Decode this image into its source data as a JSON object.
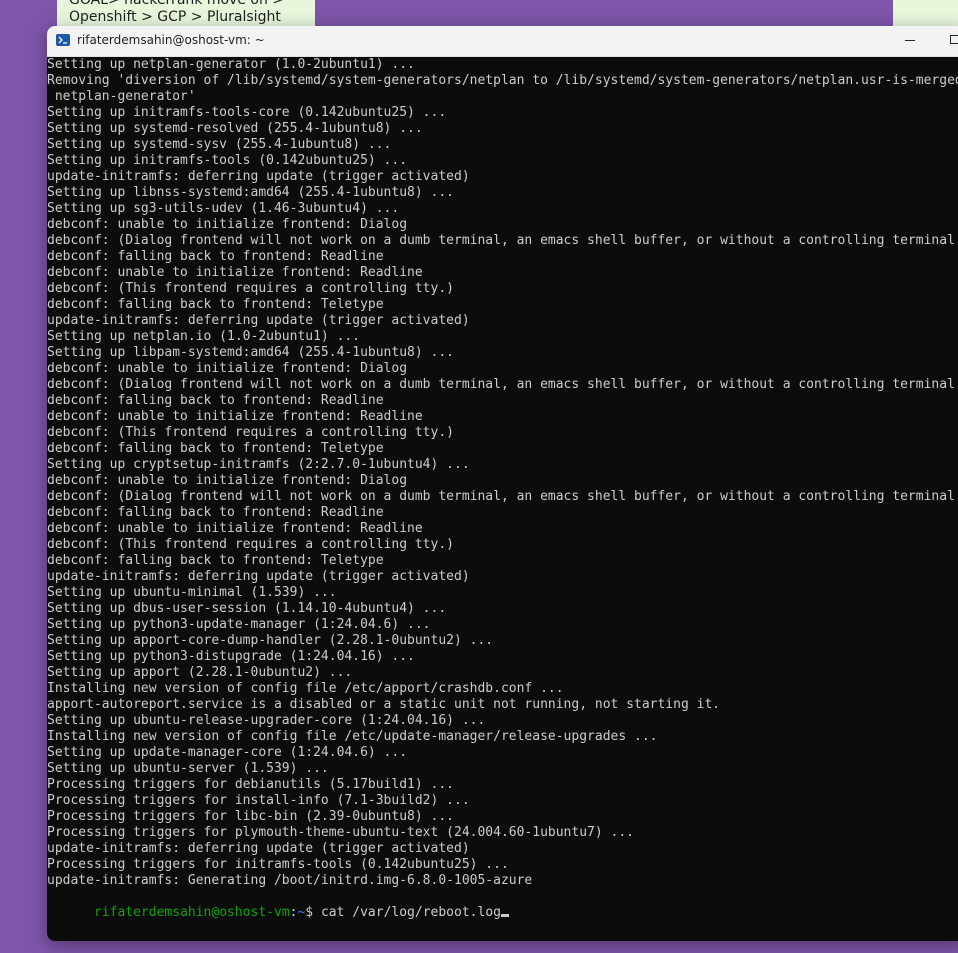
{
  "background_note": {
    "line1": "GOAL> hackerrank move on >",
    "line2": "Openshift > GCP > Pluralsight"
  },
  "window": {
    "title": "rifaterdemsahin@oshost-vm: ~",
    "icon": "terminal-icon"
  },
  "output_lines": [
    "Setting up netplan-generator (1.0-2ubuntu1) ...",
    "Removing 'diversion of /lib/systemd/system-generators/netplan to /lib/systemd/system-generators/netplan.usr-is-merged by",
    " netplan-generator'",
    "Setting up initramfs-tools-core (0.142ubuntu25) ...",
    "Setting up systemd-resolved (255.4-1ubuntu8) ...",
    "Setting up systemd-sysv (255.4-1ubuntu8) ...",
    "Setting up initramfs-tools (0.142ubuntu25) ...",
    "update-initramfs: deferring update (trigger activated)",
    "Setting up libnss-systemd:amd64 (255.4-1ubuntu8) ...",
    "Setting up sg3-utils-udev (1.46-3ubuntu4) ...",
    "debconf: unable to initialize frontend: Dialog",
    "debconf: (Dialog frontend will not work on a dumb terminal, an emacs shell buffer, or without a controlling terminal.)",
    "debconf: falling back to frontend: Readline",
    "debconf: unable to initialize frontend: Readline",
    "debconf: (This frontend requires a controlling tty.)",
    "debconf: falling back to frontend: Teletype",
    "update-initramfs: deferring update (trigger activated)",
    "Setting up netplan.io (1.0-2ubuntu1) ...",
    "Setting up libpam-systemd:amd64 (255.4-1ubuntu8) ...",
    "debconf: unable to initialize frontend: Dialog",
    "debconf: (Dialog frontend will not work on a dumb terminal, an emacs shell buffer, or without a controlling terminal.)",
    "debconf: falling back to frontend: Readline",
    "debconf: unable to initialize frontend: Readline",
    "debconf: (This frontend requires a controlling tty.)",
    "debconf: falling back to frontend: Teletype",
    "Setting up cryptsetup-initramfs (2:2.7.0-1ubuntu4) ...",
    "debconf: unable to initialize frontend: Dialog",
    "debconf: (Dialog frontend will not work on a dumb terminal, an emacs shell buffer, or without a controlling terminal.)",
    "debconf: falling back to frontend: Readline",
    "debconf: unable to initialize frontend: Readline",
    "debconf: (This frontend requires a controlling tty.)",
    "debconf: falling back to frontend: Teletype",
    "update-initramfs: deferring update (trigger activated)",
    "Setting up ubuntu-minimal (1.539) ...",
    "Setting up dbus-user-session (1.14.10-4ubuntu4) ...",
    "Setting up python3-update-manager (1:24.04.6) ...",
    "Setting up apport-core-dump-handler (2.28.1-0ubuntu2) ...",
    "Setting up python3-distupgrade (1:24.04.16) ...",
    "Setting up apport (2.28.1-0ubuntu2) ...",
    "Installing new version of config file /etc/apport/crashdb.conf ...",
    "apport-autoreport.service is a disabled or a static unit not running, not starting it.",
    "Setting up ubuntu-release-upgrader-core (1:24.04.16) ...",
    "Installing new version of config file /etc/update-manager/release-upgrades ...",
    "Setting up update-manager-core (1:24.04.6) ...",
    "Setting up ubuntu-server (1.539) ...",
    "Processing triggers for debianutils (5.17build1) ...",
    "Processing triggers for install-info (7.1-3build2) ...",
    "Processing triggers for libc-bin (2.39-0ubuntu8) ...",
    "Processing triggers for plymouth-theme-ubuntu-text (24.004.60-1ubuntu7) ...",
    "update-initramfs: deferring update (trigger activated)",
    "Processing triggers for initramfs-tools (0.142ubuntu25) ...",
    "update-initramfs: Generating /boot/initrd.img-6.8.0-1005-azure"
  ],
  "prompt": {
    "user_host": "rifaterdemsahin@oshost-vm",
    "separator": ":",
    "path": "~",
    "symbol": "$ ",
    "command": "cat /var/log/reboot.log"
  },
  "colors": {
    "desktop": "#7e55aa",
    "terminal_bg": "#0c0c0c",
    "terminal_fg": "#cccccc",
    "prompt_user": "#13a10e",
    "prompt_path": "#3b78ff"
  }
}
